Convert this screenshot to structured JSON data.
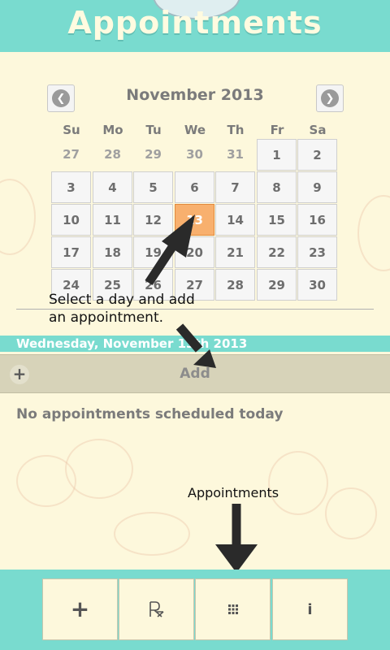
{
  "header": {
    "title": "Appointments"
  },
  "calendar": {
    "month_label": "November 2013",
    "prev_icon": "chevron-left-icon",
    "next_icon": "chevron-right-icon",
    "weekdays": [
      "Su",
      "Mo",
      "Tu",
      "We",
      "Th",
      "Fr",
      "Sa"
    ],
    "weeks": [
      [
        "27",
        "28",
        "29",
        "30",
        "31",
        "1",
        "2"
      ],
      [
        "3",
        "4",
        "5",
        "6",
        "7",
        "8",
        "9"
      ],
      [
        "10",
        "11",
        "12",
        "13",
        "14",
        "15",
        "16"
      ],
      [
        "17",
        "18",
        "19",
        "20",
        "21",
        "22",
        "23"
      ],
      [
        "24",
        "25",
        "26",
        "27",
        "28",
        "29",
        "30"
      ]
    ],
    "selected_day": "13",
    "selected_color": "#f8b06e"
  },
  "annotations": {
    "select_day": [
      "Select a day and add",
      "an appointment."
    ],
    "appointments": "Appointments"
  },
  "day_panel": {
    "date_label": "Wednesday, November 13th 2013",
    "add_label": "Add",
    "add_icon": "plus-icon",
    "empty_message": "No appointments scheduled today"
  },
  "toolbar": {
    "items": [
      {
        "name": "add",
        "icon": "plus-icon"
      },
      {
        "name": "prescription",
        "icon": "rx-icon"
      },
      {
        "name": "appointments",
        "icon": "grid-icon"
      },
      {
        "name": "info",
        "icon": "info-icon"
      }
    ]
  },
  "colors": {
    "accent": "#79dbcf",
    "background": "#fdf8dc",
    "add_bar": "#d7d3b9",
    "arrow": "#2a2a2a"
  }
}
